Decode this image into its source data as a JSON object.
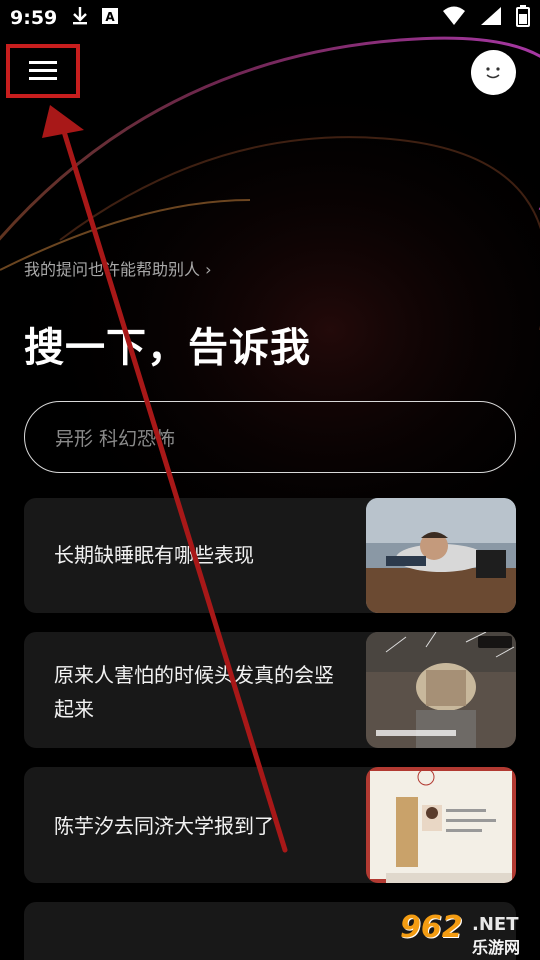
{
  "status_bar": {
    "time": "9:59",
    "icons_left": [
      "download-icon",
      "font-a-icon"
    ],
    "icons_right": [
      "wifi-icon",
      "signal-icon",
      "battery-icon"
    ]
  },
  "header": {
    "menu_icon": "hamburger-menu-icon",
    "avatar_icon": "smiley-avatar-icon"
  },
  "hint": {
    "label": "我的提问也许能帮助别人",
    "chevron": "›"
  },
  "title": "搜一下，告诉我",
  "search": {
    "placeholder": "异形 科幻恐怖"
  },
  "cards": [
    {
      "text": "长期缺睡眠有哪些表现",
      "thumb": "person-sleeping-on-desk-photo"
    },
    {
      "text": "原来人害怕的时候头发真的会竖起来",
      "thumb": "hair-standing-video-thumb"
    },
    {
      "text": "陈芋汐去同济大学报到了",
      "thumb": "university-certificate-photo"
    }
  ],
  "watermark": {
    "number": "962",
    "net": ".NET",
    "site": "乐游网"
  },
  "colors": {
    "background": "#000000",
    "card_bg": "#181818",
    "annotation_red": "#c81e1e"
  }
}
